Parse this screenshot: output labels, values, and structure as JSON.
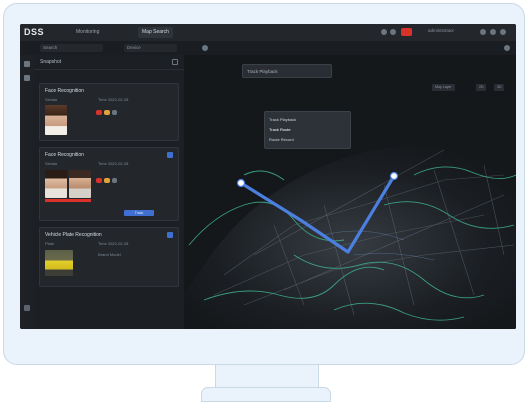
{
  "app": {
    "logo": "DSS",
    "tabs": [
      {
        "label": "Monitoring",
        "active": false
      },
      {
        "label": "Map Search",
        "active": true
      }
    ],
    "user_text": "administrator"
  },
  "toolbar": {
    "field1": "Search",
    "field2": "Device"
  },
  "panel": {
    "title": "Snapshot",
    "cards": [
      {
        "title": "Face Recognition",
        "meta1": "Similar",
        "meta2": "Time 2022-02-28"
      },
      {
        "title": "Face Recognition",
        "meta1": "Similar",
        "meta2": "Time 2022-02-28",
        "action": "Track"
      },
      {
        "title": "Vehicle Plate Recognition",
        "meta1": "Plate",
        "meta2": "Time 2022-02-28",
        "meta3": "Brand Model"
      }
    ]
  },
  "map": {
    "dropdown_label": "Track Playback",
    "menu_items": [
      {
        "label": "Track Playback",
        "selected": false
      },
      {
        "label": "Track Route",
        "selected": true
      },
      {
        "label": "Route Record",
        "selected": false
      }
    ],
    "right_tools": [
      "Map Layer",
      "2D",
      "3D"
    ]
  },
  "colors": {
    "accent": "#3f6fd1",
    "alert": "#d9322b",
    "route": "#4b7fe0",
    "roads": "#3fb58c"
  }
}
